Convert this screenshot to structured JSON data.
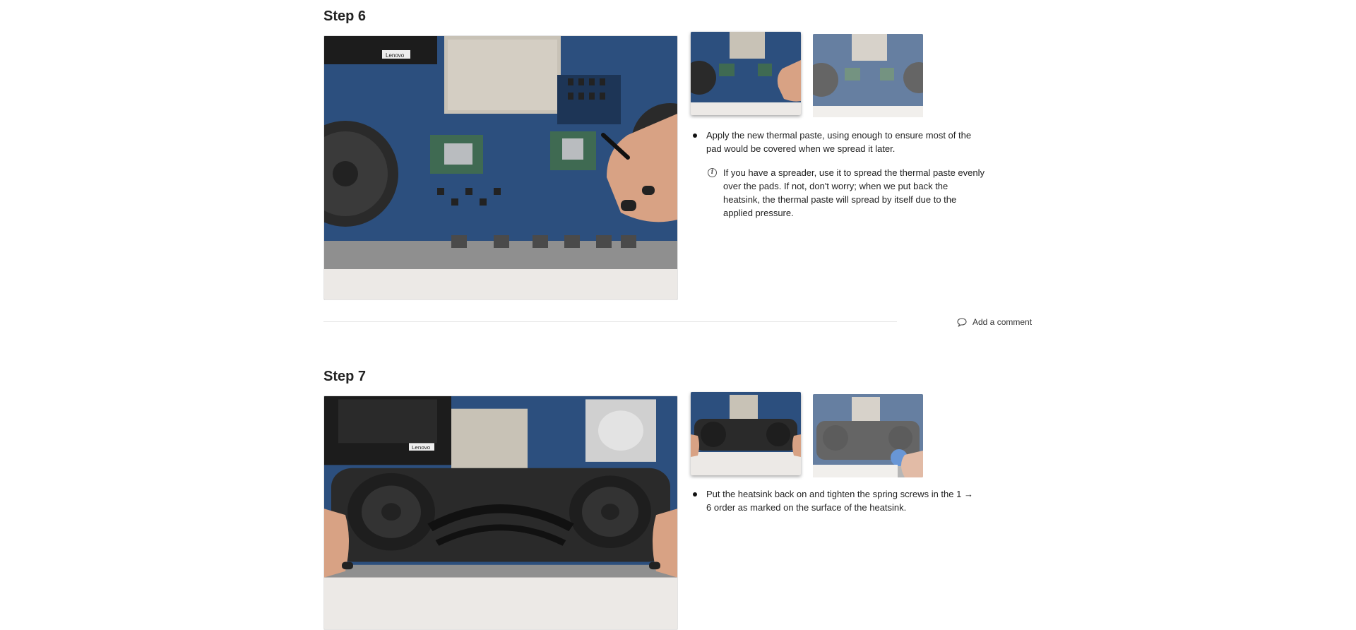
{
  "steps": [
    {
      "title": "Step 6",
      "bullets": [
        "Apply the new thermal paste, using enough to ensure most of the pad would be covered when we spread it later."
      ],
      "note": "If you have a spreader, use it to spread the thermal paste evenly over the pads. If not, don't worry; when we put back the heatsink, the thermal paste will spread by itself due to the applied pressure.",
      "note_icon": "info-icon",
      "images": {
        "main_alt": "Hand applying thermal paste on laptop motherboard",
        "brand_label": "Lenovo"
      }
    },
    {
      "title": "Step 7",
      "bullets": [
        "Put the heatsink back on and tighten the spring screws in the 1 → 6 order as marked on the surface of the heatsink."
      ],
      "images": {
        "main_alt": "Hands placing heatsink back on laptop",
        "brand_label": "Lenovo"
      }
    }
  ],
  "comment": {
    "label": "Add a comment",
    "icon": "comment-icon"
  },
  "colors": {
    "board": "#2c4f7e",
    "board_dark": "#1d3556",
    "shield": "#c8c2b6",
    "fan": "#2a2a2a",
    "case": "#8f8f8f",
    "hand": "#d8a284",
    "nail": "#222222",
    "background": "#ffffff"
  }
}
